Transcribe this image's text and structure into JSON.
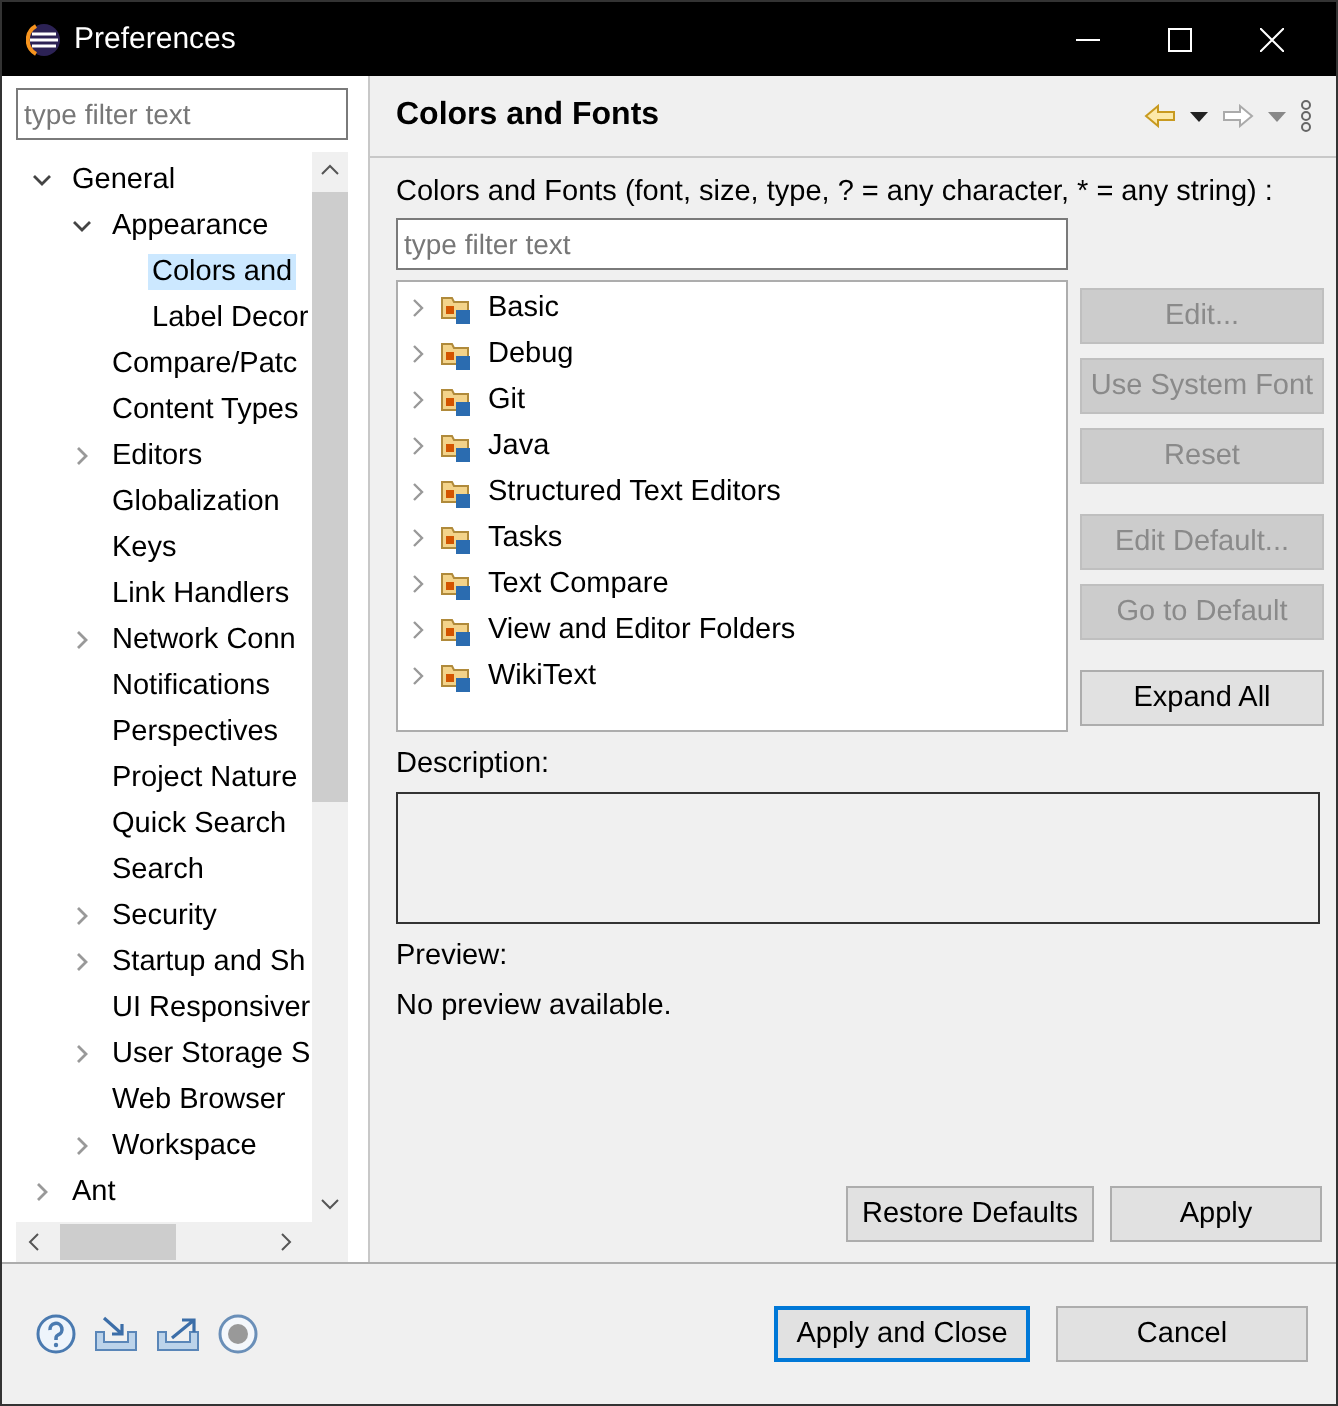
{
  "window": {
    "title": "Preferences"
  },
  "sidebar": {
    "filter": {
      "placeholder": "type filter text"
    },
    "tree": [
      {
        "label": "General",
        "expanded": true,
        "selected": false,
        "children": [
          {
            "label": "Appearance",
            "expanded": true,
            "selected": false,
            "children": [
              {
                "label": "Colors and",
                "selected": true
              },
              {
                "label": "Label Decor",
                "selected": false
              }
            ]
          },
          {
            "label": "Compare/Patc",
            "selected": false
          },
          {
            "label": "Content Types",
            "selected": false
          },
          {
            "label": "Editors",
            "expanded": false,
            "selected": false
          },
          {
            "label": "Globalization",
            "selected": false
          },
          {
            "label": "Keys",
            "selected": false
          },
          {
            "label": "Link Handlers",
            "selected": false
          },
          {
            "label": "Network Conn",
            "expanded": false,
            "selected": false
          },
          {
            "label": "Notifications",
            "selected": false
          },
          {
            "label": "Perspectives",
            "selected": false
          },
          {
            "label": "Project Nature",
            "selected": false
          },
          {
            "label": "Quick Search",
            "selected": false
          },
          {
            "label": "Search",
            "selected": false
          },
          {
            "label": "Security",
            "expanded": false,
            "selected": false
          },
          {
            "label": "Startup and Sh",
            "expanded": false,
            "selected": false
          },
          {
            "label": "UI Responsiver",
            "selected": false
          },
          {
            "label": "User Storage S",
            "expanded": false,
            "selected": false
          },
          {
            "label": "Web Browser",
            "selected": false
          },
          {
            "label": "Workspace",
            "expanded": false,
            "selected": false
          }
        ]
      },
      {
        "label": "Ant",
        "expanded": false,
        "selected": false
      }
    ]
  },
  "page": {
    "title": "Colors and Fonts",
    "filter_label": "Colors and Fonts (font, size, type, ? = any character, * = any string) :",
    "filter": {
      "placeholder": "type filter text"
    },
    "categories": [
      {
        "label": "Basic",
        "expanded": false
      },
      {
        "label": "Debug",
        "expanded": false
      },
      {
        "label": "Git",
        "expanded": false
      },
      {
        "label": "Java",
        "expanded": false
      },
      {
        "label": "Structured Text Editors",
        "expanded": false
      },
      {
        "label": "Tasks",
        "expanded": false
      },
      {
        "label": "Text Compare",
        "expanded": false
      },
      {
        "label": "View and Editor Folders",
        "expanded": false
      },
      {
        "label": "WikiText",
        "expanded": false
      }
    ],
    "button_groups": [
      [
        {
          "label": "Edit...",
          "disabled": true
        },
        {
          "label": "Use System Font",
          "disabled": true
        },
        {
          "label": "Reset",
          "disabled": true
        }
      ],
      [
        {
          "label": "Edit Default...",
          "disabled": true
        },
        {
          "label": "Go to Default",
          "disabled": true
        }
      ],
      [
        {
          "label": "Expand All",
          "disabled": false
        }
      ]
    ],
    "description_label": "Description:",
    "preview_label": "Preview:",
    "preview_text": "No preview available.",
    "page_buttons": [
      "Restore Defaults",
      "Apply"
    ]
  },
  "dialog_buttons": [
    {
      "label": "Apply and Close",
      "default": true
    },
    {
      "label": "Cancel",
      "default": false
    }
  ]
}
